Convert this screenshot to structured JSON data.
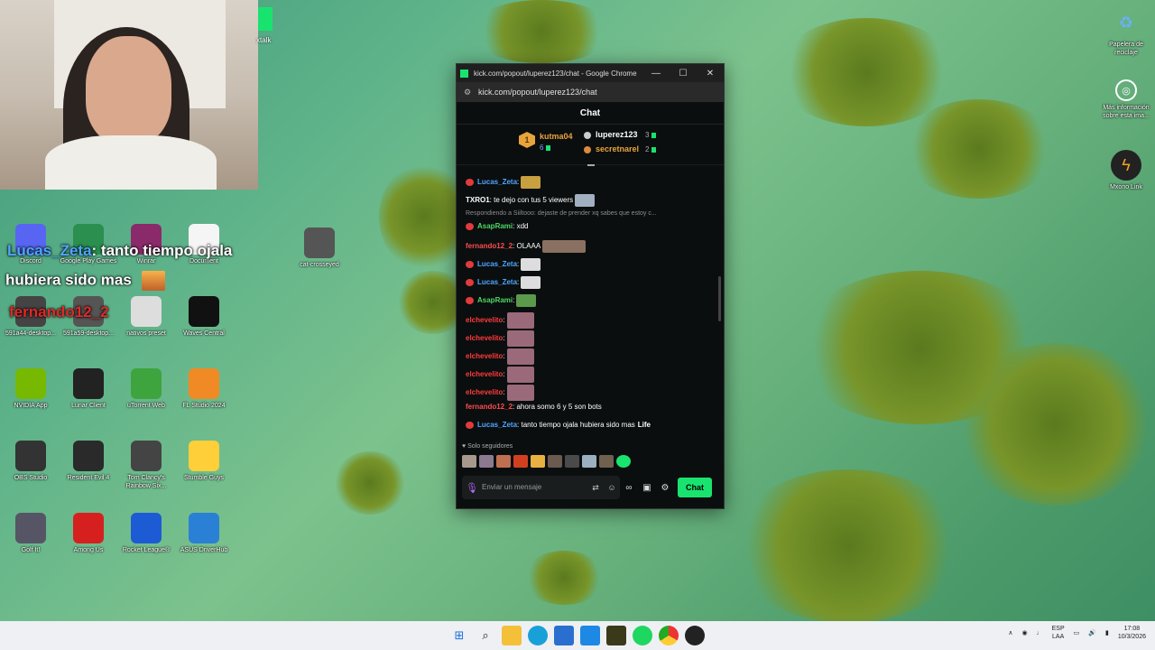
{
  "overlay": {
    "corner_app_label": "xtalk",
    "line1_user": "Lucas_Zeta",
    "line1_text": ": tanto tiempo ojala",
    "line2_text": "hubiera sido mas",
    "line3_user": "fernando12_2"
  },
  "desktop_icons": [
    {
      "label": "Discord",
      "icon": "discord-icon",
      "color": "#5865f2"
    },
    {
      "label": "Google Play Games",
      "icon": "google-play-games-icon",
      "color": "#2a8f4f"
    },
    {
      "label": "Winrar",
      "icon": "winrar-icon",
      "color": "#8a2a6a"
    },
    {
      "label": "Document",
      "icon": "document-icon",
      "color": "#f5f5f5"
    },
    {
      "label": "cat-crosseyed",
      "icon": "cat-image-icon",
      "color": "#555"
    },
    {
      "label": "591a44-desktop...",
      "icon": "folder-icon",
      "color": "#444"
    },
    {
      "label": "591a59-desktop...",
      "icon": "folder-icon",
      "color": "#555"
    },
    {
      "label": "nativos preset",
      "icon": "preset-icon",
      "color": "#ddd"
    },
    {
      "label": "Waves Central",
      "icon": "waves-icon",
      "color": "#111"
    },
    {
      "label": "NVIDIA App",
      "icon": "nvidia-icon",
      "color": "#76b900"
    },
    {
      "label": "Lunar Client",
      "icon": "lunar-client-icon",
      "color": "#222"
    },
    {
      "label": "uTorrent Web",
      "icon": "utorrent-icon",
      "color": "#3ea43e"
    },
    {
      "label": "FL Studio 2024",
      "icon": "fl-studio-icon",
      "color": "#f08a24"
    },
    {
      "label": "OBS Studio",
      "icon": "obs-icon",
      "color": "#333"
    },
    {
      "label": "Resident Evil 4",
      "icon": "re4-icon",
      "color": "#2a2a2a"
    },
    {
      "label": "Tom Clancy's Rainbow Six...",
      "icon": "r6-icon",
      "color": "#444"
    },
    {
      "label": "Stumble Guys",
      "icon": "stumble-guys-icon",
      "color": "#ffcf3a"
    },
    {
      "label": "Golf It!",
      "icon": "golf-it-icon",
      "color": "#556"
    },
    {
      "label": "Among Us",
      "icon": "among-us-icon",
      "color": "#d62020"
    },
    {
      "label": "Rocket League®",
      "icon": "rocket-league-icon",
      "color": "#1d5bd4"
    },
    {
      "label": "ASUS DriverHub",
      "icon": "asus-driverhub-icon",
      "color": "#2a80d4"
    }
  ],
  "right_icons": [
    {
      "label": "Papelera de reciclaje",
      "icon": "recycle-bin-icon"
    },
    {
      "label": "Más información sobre esta ima...",
      "icon": "info-camera-icon"
    },
    {
      "label": "Mxono Link",
      "icon": "mxono-link-icon"
    }
  ],
  "window": {
    "title": "kick.com/popout/luperez123/chat - Google Chrome",
    "url": "kick.com/popout/luperez123/chat",
    "header": "Chat"
  },
  "leaderboard": {
    "rank_badge": "1",
    "first_name": "kutma04",
    "first_count": "6",
    "second_name": "luperez123",
    "second_count": "3",
    "third_name": "secretnarel",
    "third_count": "2"
  },
  "messages": [
    {
      "user": "Lucas_Zeta",
      "color": "#4ea7ff",
      "text": ":",
      "badge": true
    },
    {
      "user": "TXRO1",
      "color": "#ffffff",
      "text": ": te dejo con tus 5 viewers",
      "badge": false
    },
    {
      "user": "AsapRami",
      "color": "#4cd964",
      "text": ": xdd",
      "badge": true,
      "reply": "Respondiendo a Siiltooo: dejaste de prender xq sabes que estoy c..."
    },
    {
      "user": "fernando12_2",
      "color": "#ff4d4d",
      "text": ": OLAAA",
      "badge": false
    },
    {
      "user": "Lucas_Zeta",
      "color": "#4ea7ff",
      "text": ":",
      "badge": true
    },
    {
      "user": "Lucas_Zeta",
      "color": "#4ea7ff",
      "text": ":",
      "badge": true
    },
    {
      "user": "AsapRami",
      "color": "#4cd964",
      "text": ":",
      "badge": true
    },
    {
      "user": "elchevelito",
      "color": "#ff3b3b",
      "text": ":",
      "badge": false
    },
    {
      "user": "elchevelito",
      "color": "#ff3b3b",
      "text": ":",
      "badge": false
    },
    {
      "user": "elchevelito",
      "color": "#ff3b3b",
      "text": ":",
      "badge": false
    },
    {
      "user": "elchevelito",
      "color": "#ff3b3b",
      "text": ":",
      "badge": false
    },
    {
      "user": "elchevelito",
      "color": "#ff3b3b",
      "text": ":",
      "badge": false
    },
    {
      "user": "fernando12_2",
      "color": "#ff4d4d",
      "text": ": ahora somo 6 y 5 son bots",
      "badge": false
    },
    {
      "user": "Lucas_Zeta",
      "color": "#4ea7ff",
      "text": ": tanto tiempo ojala hubiera sido mas",
      "badge": true,
      "emote_text": "Life"
    }
  ],
  "followers_label": "Solo seguidores",
  "input_placeholder": "Enviar un mensaje",
  "chat_button": "Chat",
  "tray": {
    "lang1": "ESP",
    "lang2": "LAA",
    "time": "17:08",
    "date": "10/3/2026"
  },
  "accent": "#19e36f"
}
